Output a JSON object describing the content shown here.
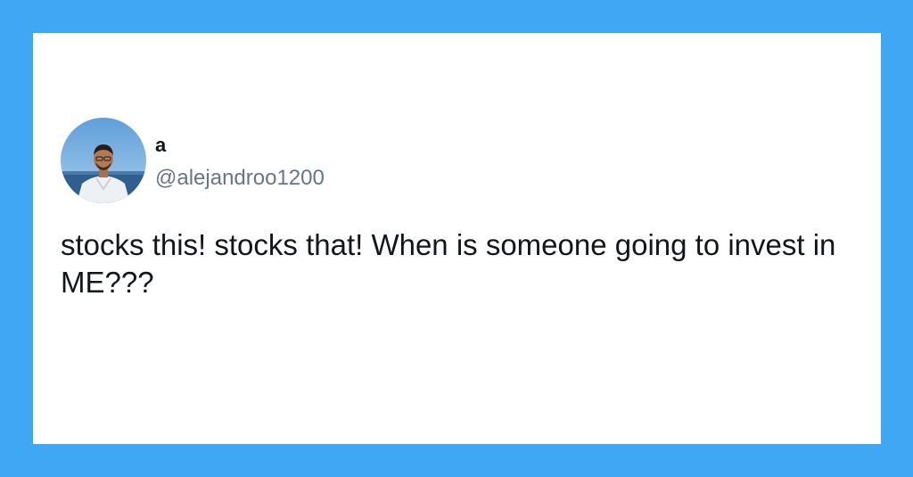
{
  "colors": {
    "frame": "#3fa7f4",
    "card": "#ffffff",
    "name_text": "#14171a",
    "handle_text": "#657786"
  },
  "tweet": {
    "author": {
      "display_name": "a",
      "handle": "@alejandroo1200",
      "avatar_icon": "profile-photo-icon"
    },
    "text": "stocks this! stocks that! When is someone going to invest in ME???"
  }
}
